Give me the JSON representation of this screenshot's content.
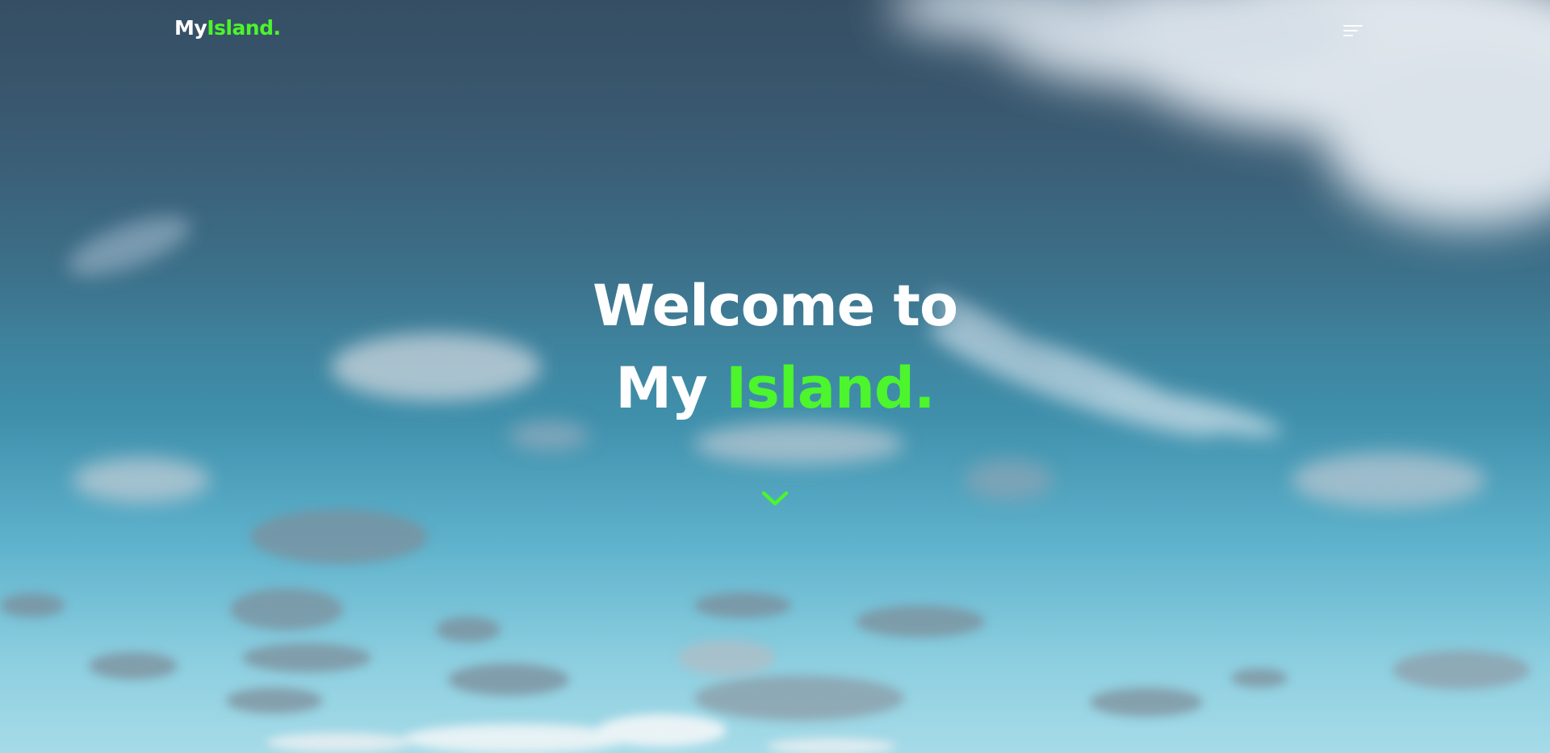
{
  "brand": {
    "logo_part1": "My",
    "logo_part2": "Island."
  },
  "hero": {
    "headline_line1": "Welcome to",
    "headline_line2_white": "My",
    "headline_line2_accent": "Island."
  },
  "icons": {
    "menu": "menu-hamburger-icon",
    "scroll": "chevron-down-icon"
  },
  "colors": {
    "accent": "#4cf52c",
    "text": "#ffffff",
    "sky_top": "#3d5a72",
    "sky_bottom": "#a6dbe8"
  }
}
